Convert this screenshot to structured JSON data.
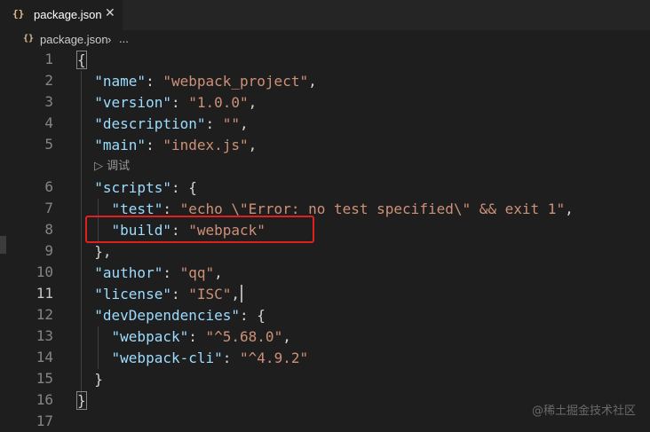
{
  "tab": {
    "icon": "{}",
    "label": "package.json",
    "close": "✕"
  },
  "breadcrumb": {
    "icon": "{}",
    "file": "package.json",
    "separator": "›",
    "more": "..."
  },
  "gutter": [
    "1",
    "2",
    "3",
    "4",
    "5",
    "6",
    "7",
    "8",
    "9",
    "10",
    "11",
    "12",
    "13",
    "14",
    "15",
    "16",
    "17"
  ],
  "codelens": "▷ 调试",
  "code": {
    "l1": "{",
    "l2_key": "\"name\"",
    "l2_val": "\"webpack_project\"",
    "l3_key": "\"version\"",
    "l3_val": "\"1.0.0\"",
    "l4_key": "\"description\"",
    "l4_val": "\"\"",
    "l5_key": "\"main\"",
    "l5_val": "\"index.js\"",
    "l6_key": "\"scripts\"",
    "l7_key": "\"test\"",
    "l7_val": "\"echo \\\"Error: no test specified\\\" && exit 1\"",
    "l8_key": "\"build\"",
    "l8_val": "\"webpack\"",
    "l9": "},",
    "l10_key": "\"author\"",
    "l10_val": "\"qq\"",
    "l11_key": "\"license\"",
    "l11_val": "\"ISC\"",
    "l12_key": "\"devDependencies\"",
    "l13_key": "\"webpack\"",
    "l13_val": "\"^5.68.0\"",
    "l14_key": "\"webpack-cli\"",
    "l14_val": "\"^4.9.2\"",
    "l15": "}",
    "l16": "}"
  },
  "watermark": "@稀土掘金技术社区",
  "colors": {
    "key": "#9cdcfe",
    "string": "#ce9178",
    "highlight": "#e02020",
    "background": "#1e1e1e"
  }
}
